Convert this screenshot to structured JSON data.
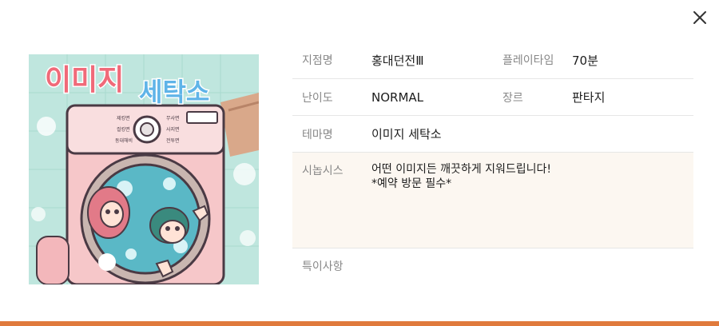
{
  "poster": {
    "title_word1": "이미지",
    "title_word2": "세탁소",
    "knob_labels": [
      "제킹면",
      "무사면",
      "컬킹면",
      "사지면",
      "동대해비",
      "전투면"
    ]
  },
  "details": {
    "branch_label": "지점명",
    "branch_value": "홍대던전Ⅲ",
    "playtime_label": "플레이타임",
    "playtime_value": "70분",
    "difficulty_label": "난이도",
    "difficulty_value": "NORMAL",
    "genre_label": "장르",
    "genre_value": "판타지",
    "theme_label": "테마명",
    "theme_value": "이미지 세탁소",
    "synopsis_label": "시놉시스",
    "synopsis_line1": "어떤 이미지든 깨끗하게 지워드립니다!",
    "synopsis_line2": "*예약 방문 필수*",
    "notes_label": "특이사항",
    "notes_value": ""
  },
  "colors": {
    "accent_bar": "#e07a3c",
    "synopsis_bg": "#fcf7f1"
  }
}
